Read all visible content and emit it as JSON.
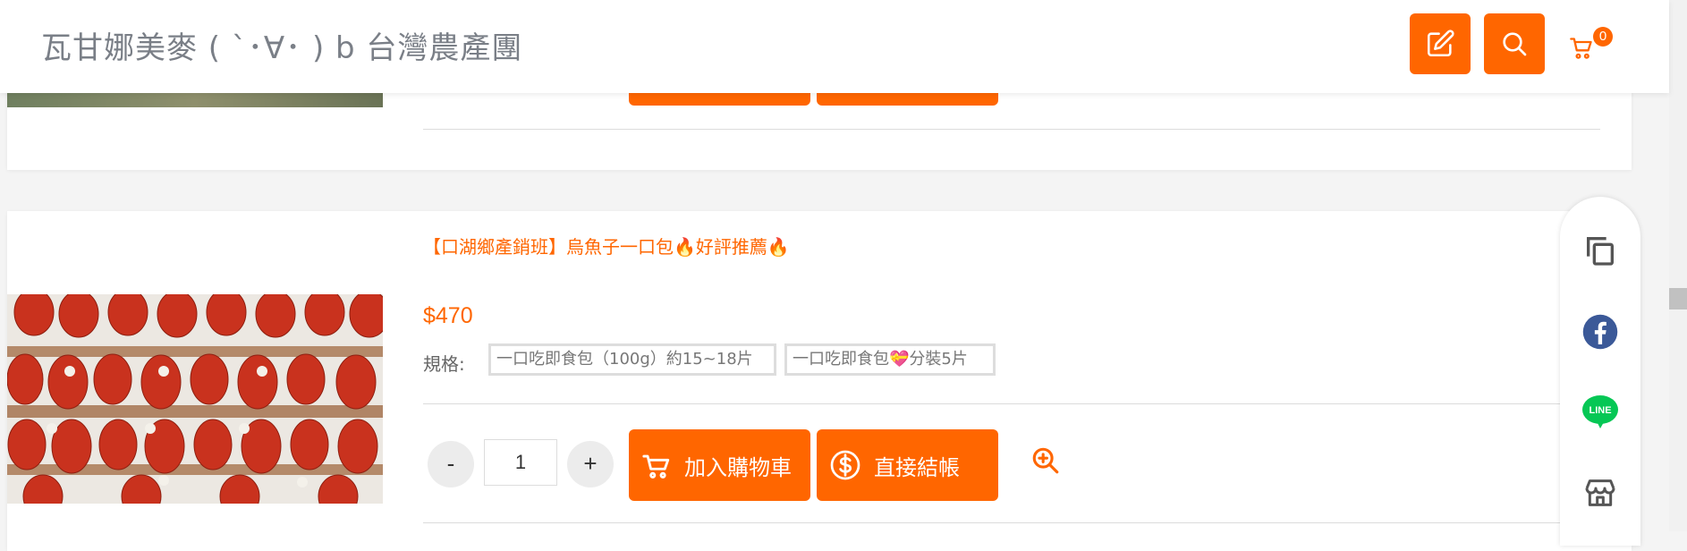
{
  "header": {
    "site_title": "瓦甘娜美麥 ( `･∀･ ) b 台灣農產團",
    "cart_count": "0"
  },
  "product": {
    "name": "【口湖鄉產銷班】烏魚子一口包🔥好評推薦🔥",
    "price": "$470",
    "spec_label": "規格:",
    "spec_options": [
      "一口吃即食包（100g）約15~18片",
      "一口吃即食包💝分裝5片"
    ],
    "qty_minus": "-",
    "qty_value": "1",
    "qty_plus": "+",
    "add_to_cart": "加入購物車",
    "checkout": "直接結帳"
  },
  "share": {
    "icons": [
      "copy-icon",
      "facebook-icon",
      "line-icon",
      "store-icon"
    ],
    "line_text": "LINE"
  },
  "colors": {
    "accent": "#ff6600",
    "facebook": "#3b5998",
    "line": "#06c755"
  }
}
